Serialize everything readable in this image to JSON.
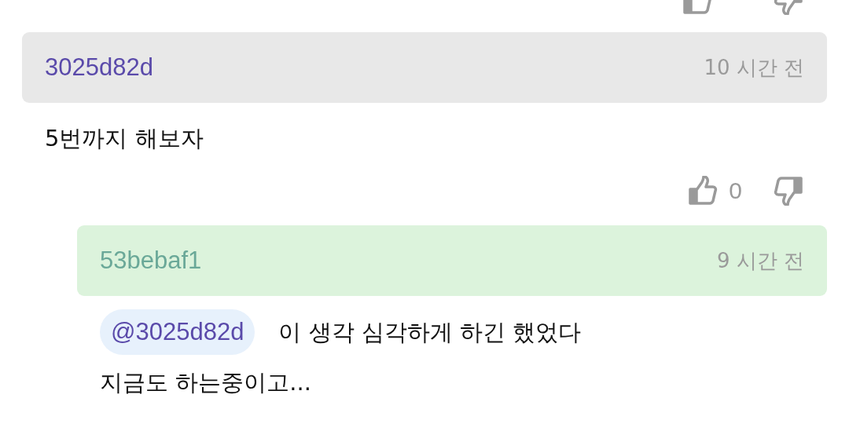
{
  "comments": [
    {
      "kind": "comment",
      "author": "3025d82d",
      "time": "10 시간 전",
      "lines": [
        "5번까지 해보자"
      ],
      "likes": "0"
    },
    {
      "kind": "reply",
      "author": "53bebaf1",
      "time": "9 시간 전",
      "mention": "@3025d82d",
      "lines": [
        "이 생각 심각하게 하긴 했었다",
        "지금도 하는중이고..."
      ]
    }
  ]
}
